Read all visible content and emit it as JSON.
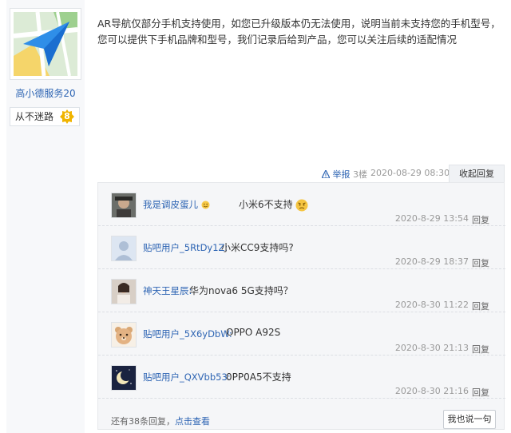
{
  "user": {
    "name": "高小德服务20",
    "level_name": "从不迷路",
    "level": "8"
  },
  "post": {
    "line1": "AR导航仅部分手机支持使用，如您已升级版本仍无法使用，说明当前未支持您的手机型号，",
    "line2": "您可以提供下手机品牌和型号，我们记录后给到产品，您可以关注后续的适配情况",
    "report_label": "举报",
    "floor": "3楼",
    "timestamp": "2020-08-29 08:30",
    "collapse_label": "收起回复"
  },
  "replies": [
    {
      "name": "我是调皮蛋儿",
      "text": "小米6不支持",
      "time": "2020-8-29 13:54",
      "reply_label": "回复",
      "avatar": "photo-avatar-icon"
    },
    {
      "name": "贴吧用户_5RtDy1Z:",
      "text": "小米CC9支持吗?",
      "time": "2020-8-29 18:37",
      "reply_label": "回复",
      "avatar": "default-avatar-icon"
    },
    {
      "name": "神天王星辰:",
      "text": "华为nova6 5G支持吗？",
      "time": "2020-8-30 11:22",
      "reply_label": "回复",
      "avatar": "photo-avatar-icon"
    },
    {
      "name": "贴吧用户_5X6yDbW:",
      "text": "OPPO A92S",
      "time": "2020-8-30 21:13",
      "reply_label": "回复",
      "avatar": "bear-avatar-icon"
    },
    {
      "name": "贴吧用户_QXVbb53:",
      "text": "0PP0A5不支持",
      "time": "2020-8-30 21:16",
      "reply_label": "回复",
      "avatar": "moon-avatar-icon"
    }
  ],
  "footer": {
    "more_prefix": "还有38条回复，",
    "more_link": "点击查看",
    "say_label": "我也说一句"
  },
  "colors": {
    "link": "#2d64b3",
    "badge": "#f0b400"
  }
}
